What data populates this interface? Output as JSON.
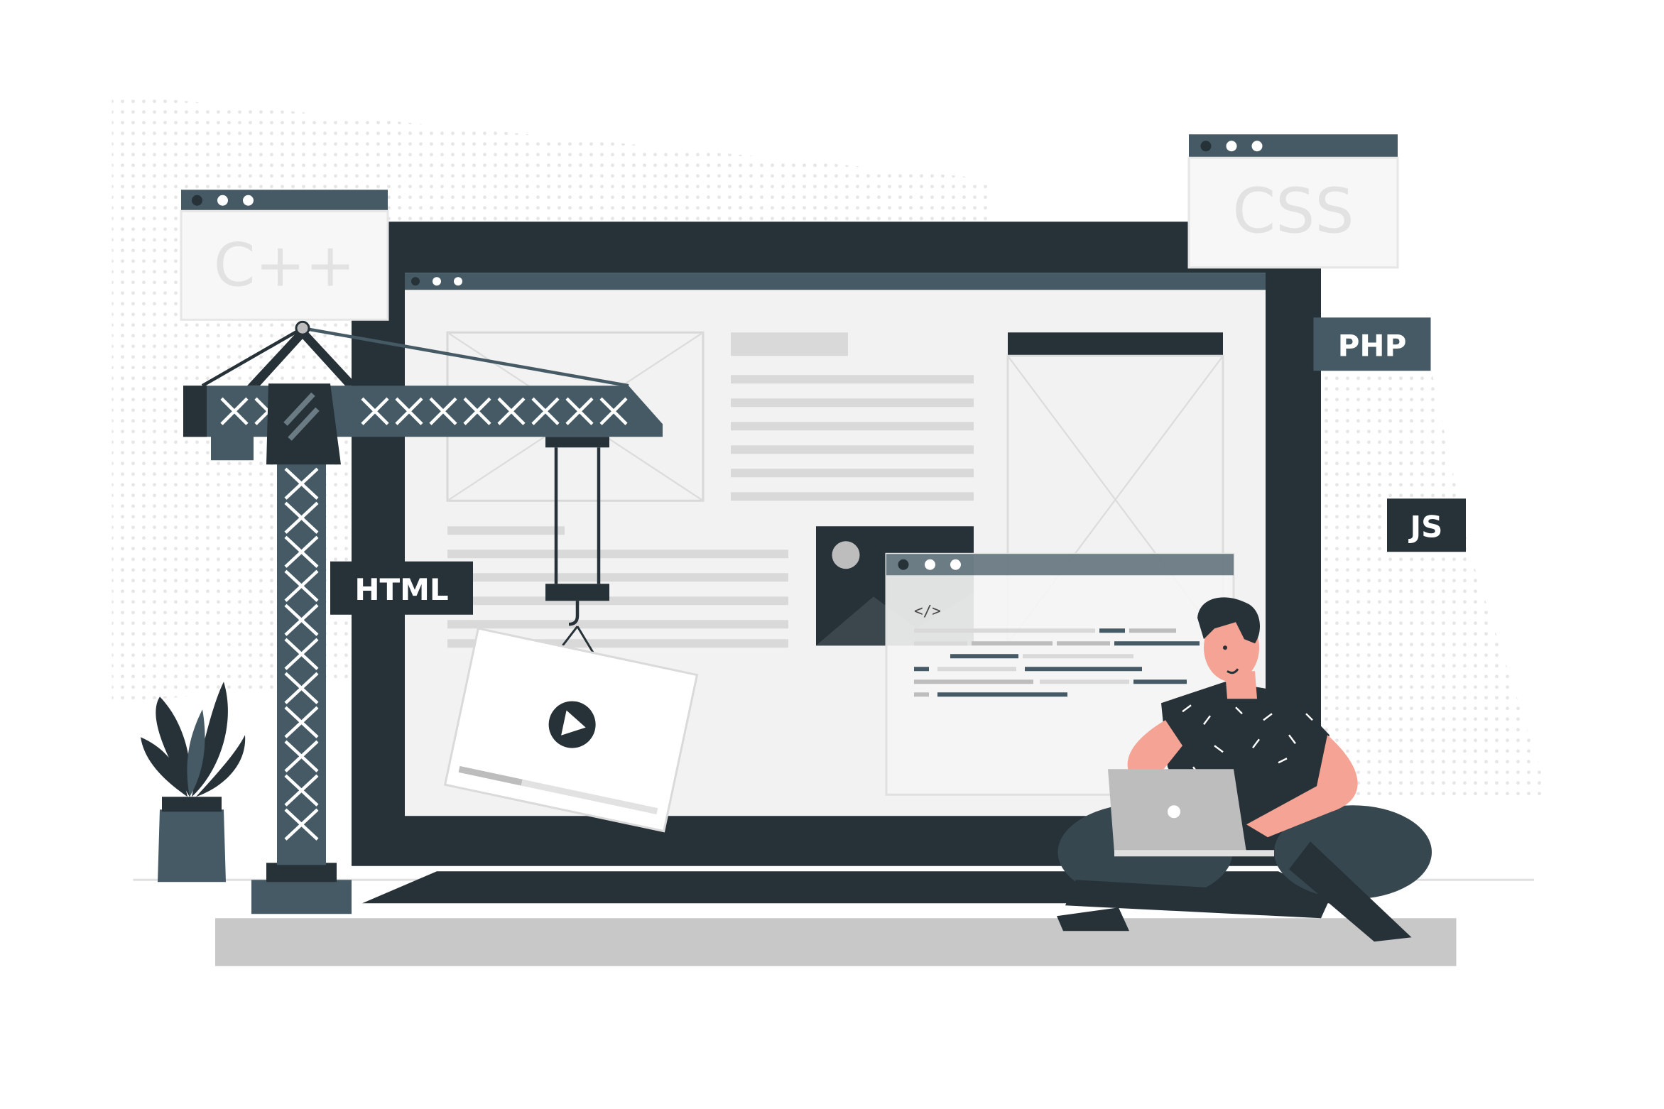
{
  "labels": {
    "cpp": "C++",
    "css": "CSS",
    "php": "PHP",
    "js": "JS",
    "html": "HTML",
    "code": "</>"
  },
  "icons": {
    "play": "play-icon",
    "image": "image-placeholder-icon"
  },
  "colors": {
    "dark": "#263238",
    "slate": "#455a64",
    "light_gray": "#d9d9d9",
    "mid_gray": "#bdbdbd",
    "skin": "#f4a394",
    "white": "#ffffff"
  }
}
